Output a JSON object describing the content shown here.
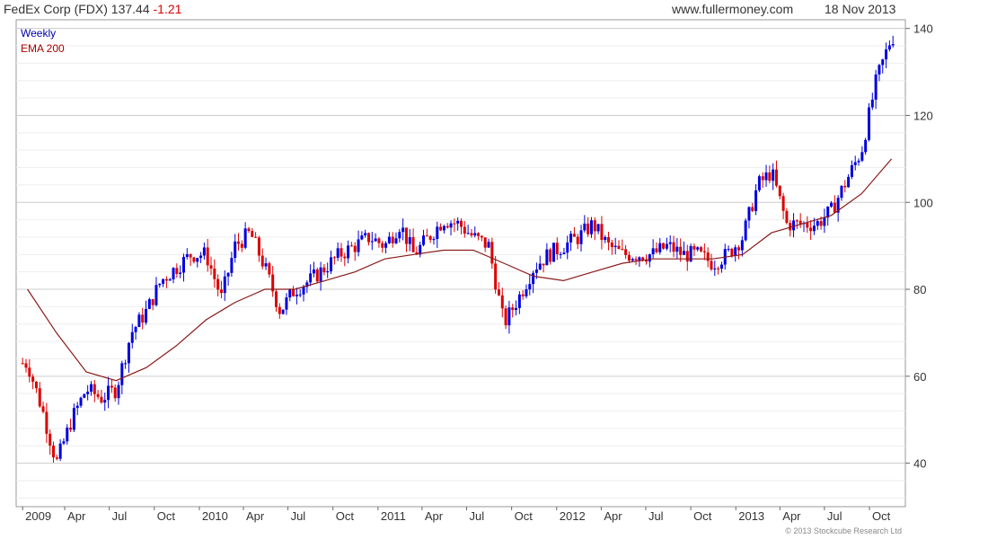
{
  "header": {
    "ticker": "FedEx Corp (FDX) 137.44",
    "change": "-1.21",
    "website": "www.fullermoney.com",
    "date": "18 Nov 2013"
  },
  "legend": {
    "period": "Weekly",
    "indicator": "EMA 200"
  },
  "copyright": "© 2013 Stockcube Research Ltd",
  "colors": {
    "up": "#0000dd",
    "down": "#dd0000",
    "ema": "#8b1a1a",
    "grid": "#dddddd",
    "period_label": "#0000aa",
    "indicator_label": "#aa0000"
  },
  "chart_data": {
    "type": "line",
    "title": "FedEx Corp (FDX) 137.44 -1.21",
    "frequency": "Weekly",
    "ylim": [
      30,
      142
    ],
    "y_ticks": [
      40,
      60,
      80,
      100,
      120,
      140
    ],
    "x_ticks": [
      "2009",
      "Apr",
      "Jul",
      "Oct",
      "2010",
      "Apr",
      "Jul",
      "Oct",
      "2011",
      "Apr",
      "Jul",
      "Oct",
      "2012",
      "Apr",
      "Jul",
      "Oct",
      "2013",
      "Apr",
      "Jul",
      "Oct"
    ],
    "grid": true,
    "legend_position": "top-left",
    "series": [
      {
        "name": "Weekly",
        "style": "candlestick",
        "x": [
          "2009-01",
          "2009-02",
          "2009-03",
          "2009-04",
          "2009-05",
          "2009-06",
          "2009-07",
          "2009-08",
          "2009-09",
          "2009-10",
          "2009-11",
          "2009-12",
          "2010-01",
          "2010-02",
          "2010-03",
          "2010-04",
          "2010-05",
          "2010-06",
          "2010-07",
          "2010-08",
          "2010-09",
          "2010-10",
          "2010-11",
          "2010-12",
          "2011-01",
          "2011-02",
          "2011-03",
          "2011-04",
          "2011-05",
          "2011-06",
          "2011-07",
          "2011-08",
          "2011-09",
          "2011-10",
          "2011-11",
          "2011-12",
          "2012-01",
          "2012-02",
          "2012-03",
          "2012-04",
          "2012-05",
          "2012-06",
          "2012-07",
          "2012-08",
          "2012-09",
          "2012-10",
          "2012-11",
          "2012-12",
          "2013-01",
          "2013-02",
          "2013-03",
          "2013-04",
          "2013-05",
          "2013-06",
          "2013-07",
          "2013-08",
          "2013-09",
          "2013-10",
          "2013-11"
        ],
        "values": [
          63,
          52,
          40,
          50,
          57,
          55,
          57,
          70,
          75,
          82,
          85,
          88,
          88,
          78,
          90,
          93,
          85,
          75,
          80,
          82,
          85,
          88,
          90,
          92,
          90,
          95,
          88,
          92,
          96,
          95,
          92,
          90,
          72,
          78,
          85,
          88,
          90,
          92,
          95,
          90,
          88,
          88,
          88,
          90,
          88,
          88,
          86,
          88,
          92,
          104,
          107,
          95,
          95,
          95,
          98,
          105,
          112,
          128,
          138
        ]
      },
      {
        "name": "EMA 200",
        "style": "line",
        "x": [
          "2009-01",
          "2009-03",
          "2009-05",
          "2009-07",
          "2009-09",
          "2009-11",
          "2010-01",
          "2010-03",
          "2010-05",
          "2010-07",
          "2010-09",
          "2010-11",
          "2011-01",
          "2011-03",
          "2011-05",
          "2011-07",
          "2011-09",
          "2011-11",
          "2012-01",
          "2012-03",
          "2012-05",
          "2012-07",
          "2012-09",
          "2012-11",
          "2013-01",
          "2013-03",
          "2013-05",
          "2013-07",
          "2013-09",
          "2013-11"
        ],
        "values": [
          80,
          70,
          61,
          59,
          62,
          67,
          73,
          77,
          80,
          80,
          82,
          84,
          87,
          88,
          89,
          89,
          86,
          83,
          82,
          84,
          86,
          87,
          87,
          87,
          88,
          93,
          95,
          97,
          102,
          110
        ]
      }
    ]
  }
}
